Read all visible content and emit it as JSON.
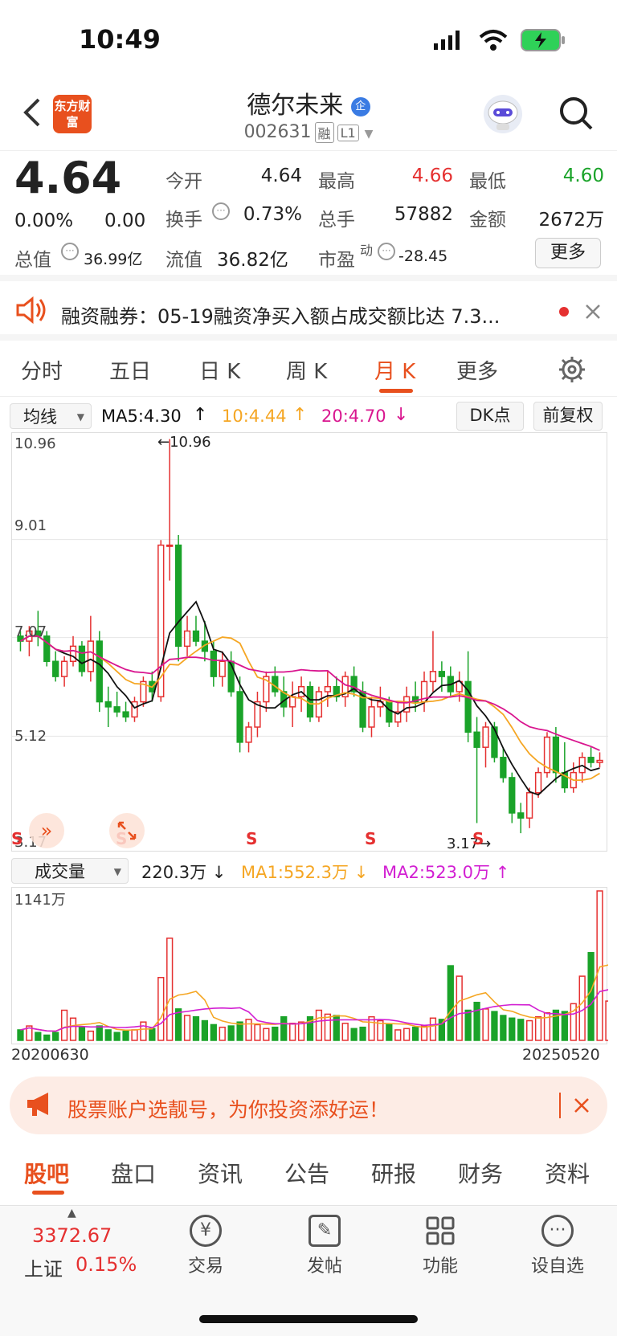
{
  "status": {
    "time": "10:49"
  },
  "header": {
    "logo_text": "东方财富",
    "name": "德尔未来",
    "name_badge": "企",
    "code": "002631",
    "tag1": "融",
    "tag2": "L1"
  },
  "quote": {
    "price": "4.64",
    "change_pct": "0.00%",
    "change": "0.00",
    "open_label": "今开",
    "open": "4.64",
    "high_label": "最高",
    "high": "4.66",
    "low_label": "最低",
    "low": "4.60",
    "turnover_label": "换手",
    "turnover": "0.73%",
    "volume_label": "总手",
    "volume": "57882",
    "amount_label": "金额",
    "amount": "2672万",
    "mcap_label": "总值",
    "mcap": "36.99亿",
    "float_label": "流值",
    "float": "36.82亿",
    "pe_label": "市盈",
    "pe_sup": "动",
    "pe": "-28.45",
    "more": "更多"
  },
  "news": {
    "text": "融资融券：05-19融资净买入额占成交额比达 7.3..."
  },
  "tabs": [
    "分时",
    "五日",
    "日 K",
    "周 K",
    "月 K",
    "更多"
  ],
  "active_tab": "月 K",
  "ma": {
    "select": "均线",
    "ma5": "MA5:4.30",
    "ma10": "10:4.44",
    "ma20": "20:4.70",
    "dk": "DK点",
    "adjust": "前复权",
    "colors": {
      "ma5": "#111111",
      "ma10": "#f5a623",
      "ma20": "#d9168f"
    }
  },
  "vol": {
    "select": "成交量",
    "value": "220.3万",
    "ma1": "MA1:552.3万",
    "ma2": "MA2:523.0万",
    "max_label": "1141万",
    "start_date": "20200630",
    "end_date": "20250520"
  },
  "chart_data": {
    "type": "candlestick",
    "period": "monthly",
    "y_ticks": [
      "10.96",
      "9.01",
      "7.07",
      "5.12",
      "3.17"
    ],
    "ylim": [
      3.17,
      10.96
    ],
    "max_marker": "10.96",
    "min_marker": "3.17",
    "signals": [
      "S",
      "S",
      "S",
      "S",
      "S"
    ],
    "candles": [
      [
        7.1,
        7.2,
        6.8,
        7.0
      ],
      [
        7.0,
        7.3,
        6.7,
        7.2
      ],
      [
        7.2,
        7.6,
        6.9,
        7.1
      ],
      [
        7.1,
        7.2,
        6.5,
        6.6
      ],
      [
        6.6,
        6.8,
        6.2,
        6.3
      ],
      [
        6.3,
        6.7,
        6.1,
        6.6
      ],
      [
        6.6,
        7.1,
        6.5,
        6.9
      ],
      [
        6.9,
        7.0,
        6.3,
        6.4
      ],
      [
        6.4,
        7.5,
        6.2,
        7.0
      ],
      [
        7.0,
        7.2,
        5.6,
        5.8
      ],
      [
        5.8,
        6.1,
        5.3,
        5.7
      ],
      [
        5.7,
        6.0,
        5.5,
        5.6
      ],
      [
        5.6,
        5.8,
        5.4,
        5.5
      ],
      [
        5.5,
        5.9,
        5.4,
        5.8
      ],
      [
        5.8,
        6.3,
        5.7,
        6.2
      ],
      [
        6.2,
        6.4,
        5.8,
        6.0
      ],
      [
        5.9,
        9.0,
        5.8,
        8.9
      ],
      [
        8.9,
        11.0,
        8.2,
        8.9
      ],
      [
        8.9,
        9.1,
        6.6,
        6.9
      ],
      [
        6.9,
        7.5,
        6.7,
        7.2
      ],
      [
        7.2,
        7.5,
        6.9,
        7.0
      ],
      [
        7.0,
        7.4,
        6.6,
        6.8
      ],
      [
        6.8,
        7.0,
        6.1,
        6.3
      ],
      [
        6.3,
        6.8,
        6.1,
        6.6
      ],
      [
        6.6,
        6.8,
        5.9,
        6.0
      ],
      [
        6.0,
        6.3,
        4.8,
        5.0
      ],
      [
        5.0,
        5.4,
        4.8,
        5.3
      ],
      [
        5.3,
        6.0,
        5.1,
        5.8
      ],
      [
        5.8,
        6.4,
        5.6,
        6.3
      ],
      [
        6.3,
        6.5,
        5.9,
        6.0
      ],
      [
        6.0,
        6.3,
        5.5,
        5.7
      ],
      [
        5.7,
        6.2,
        5.3,
        5.9
      ],
      [
        5.9,
        6.3,
        5.6,
        6.1
      ],
      [
        6.1,
        6.2,
        5.4,
        5.5
      ],
      [
        5.5,
        6.1,
        5.4,
        6.0
      ],
      [
        6.0,
        6.4,
        5.7,
        6.1
      ],
      [
        6.1,
        6.3,
        5.8,
        5.9
      ],
      [
        5.9,
        6.4,
        5.7,
        6.3
      ],
      [
        6.3,
        6.5,
        5.9,
        6.0
      ],
      [
        6.0,
        6.2,
        5.2,
        5.3
      ],
      [
        5.3,
        5.9,
        5.1,
        5.7
      ],
      [
        5.7,
        6.1,
        5.5,
        5.8
      ],
      [
        5.8,
        5.9,
        5.3,
        5.4
      ],
      [
        5.4,
        5.8,
        5.3,
        5.6
      ],
      [
        5.6,
        6.1,
        5.4,
        5.9
      ],
      [
        5.9,
        6.2,
        5.6,
        5.8
      ],
      [
        5.8,
        6.4,
        5.6,
        6.2
      ],
      [
        6.2,
        7.2,
        6.0,
        6.4
      ],
      [
        6.4,
        6.6,
        6.0,
        6.3
      ],
      [
        6.3,
        6.5,
        5.9,
        6.0
      ],
      [
        6.0,
        6.4,
        5.8,
        6.2
      ],
      [
        6.2,
        6.8,
        5.0,
        5.2
      ],
      [
        5.2,
        5.5,
        3.4,
        4.9
      ],
      [
        4.9,
        5.4,
        4.5,
        5.3
      ],
      [
        5.3,
        5.4,
        4.6,
        4.7
      ],
      [
        4.7,
        4.9,
        4.2,
        4.3
      ],
      [
        4.3,
        4.4,
        3.4,
        3.6
      ],
      [
        3.6,
        3.8,
        3.2,
        3.5
      ],
      [
        3.5,
        4.1,
        3.3,
        4.0
      ],
      [
        4.0,
        4.5,
        3.9,
        4.4
      ],
      [
        4.4,
        5.2,
        4.3,
        5.1
      ],
      [
        5.1,
        5.3,
        4.2,
        4.4
      ],
      [
        4.4,
        5.0,
        4.0,
        4.1
      ],
      [
        4.1,
        4.6,
        4.0,
        4.4
      ],
      [
        4.4,
        4.8,
        4.2,
        4.7
      ],
      [
        4.7,
        4.9,
        4.5,
        4.6
      ],
      [
        4.6,
        4.8,
        4.5,
        4.64
      ]
    ],
    "volume": [
      80,
      110,
      60,
      40,
      60,
      230,
      170,
      100,
      70,
      110,
      80,
      60,
      70,
      80,
      140,
      90,
      480,
      780,
      240,
      190,
      180,
      150,
      120,
      100,
      110,
      140,
      160,
      120,
      90,
      100,
      180,
      130,
      140,
      180,
      230,
      200,
      190,
      130,
      90,
      100,
      180,
      150,
      120,
      80,
      90,
      100,
      110,
      170,
      160,
      570,
      490,
      230,
      290,
      240,
      220,
      190,
      170,
      160,
      150,
      180,
      210,
      230,
      220,
      280,
      490,
      670,
      1141,
      300,
      220
    ]
  },
  "ad": {
    "text": "股票账户选靓号，为你投资添好运！"
  },
  "bottom_tabs": [
    "股吧",
    "盘口",
    "资讯",
    "公告",
    "研报",
    "财务",
    "资料"
  ],
  "toolbar": {
    "index_value": "3372.67",
    "index_name": "上证",
    "index_change": "0.15%",
    "items": [
      "交易",
      "发帖",
      "功能",
      "设自选"
    ]
  }
}
